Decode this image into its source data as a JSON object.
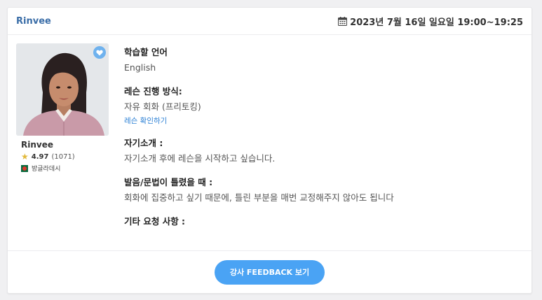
{
  "header": {
    "tutor_name": "Rinvee",
    "schedule": "2023년 7월 16일 일요일 19:00~19:25"
  },
  "tutor": {
    "name": "Rinvee",
    "rating": "4.97",
    "review_count": "(1071)",
    "country": "방글라데시"
  },
  "details": {
    "language_label": "학습할 언어",
    "language_value": "English",
    "method_label": "레슨 진행 방식:",
    "method_value": "자유 회화 (프리토킹)",
    "method_link": "레슨 확인하기",
    "intro_label": "자기소개 :",
    "intro_value": "자기소개 후에 레슨을 시작하고 싶습니다.",
    "correction_label": "발음/문법이 틀렸을 때 :",
    "correction_value": "회화에 집중하고 싶기 때문에, 틀린 부분을 매번 교정해주지 않아도 됩니다",
    "other_label": "기타 요청 사항 :"
  },
  "footer": {
    "feedback_button": "강사 FEEDBACK 보기"
  },
  "colors": {
    "accent": "#4aa3f4",
    "link": "#2a7fd4",
    "header_name": "#3b6ea8"
  }
}
